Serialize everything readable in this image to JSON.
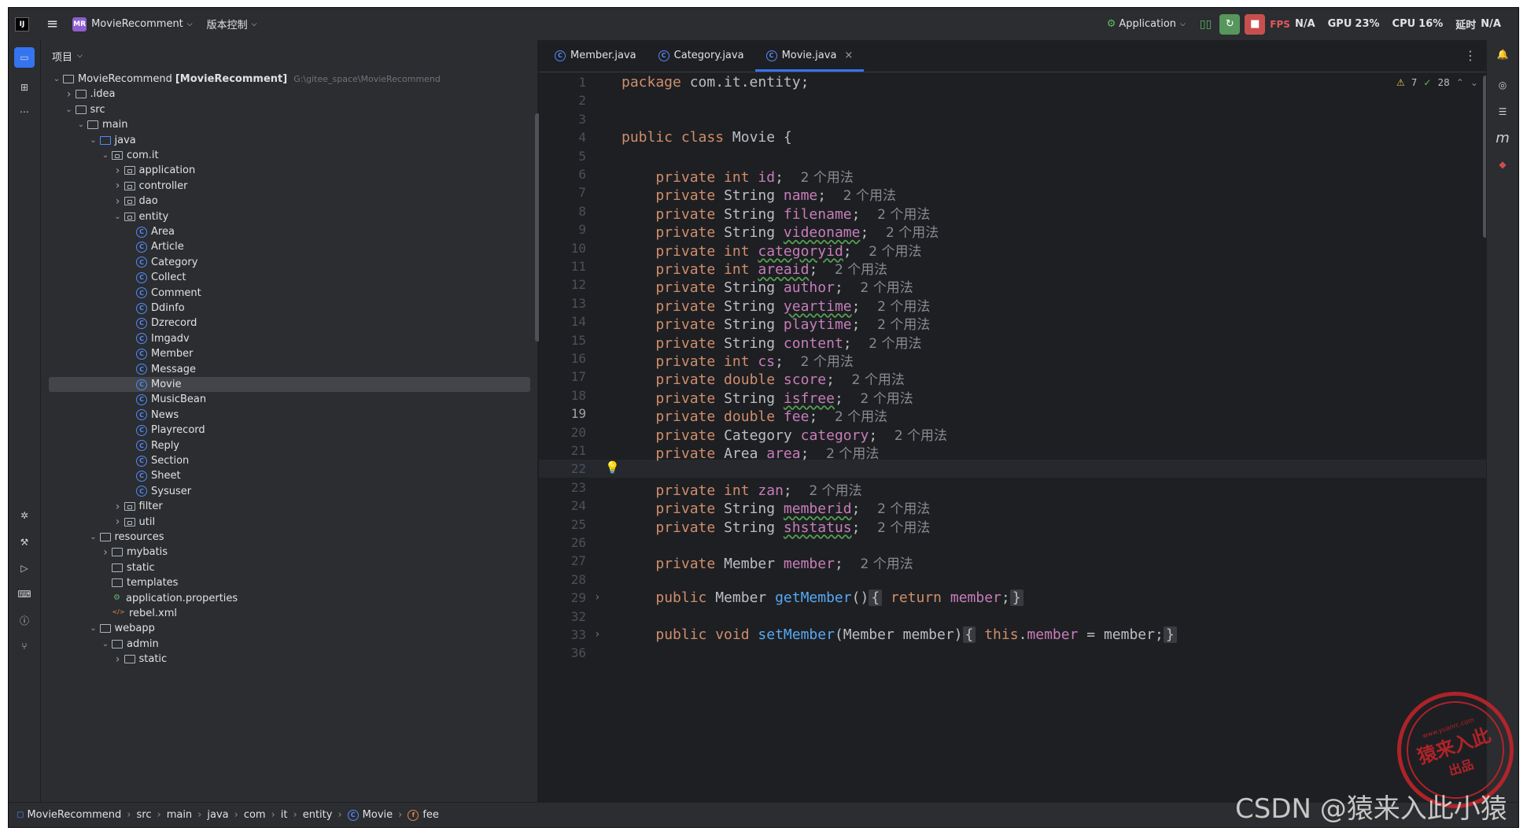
{
  "titlebar": {
    "app_logo": "intellij-icon",
    "project_badge": "MR",
    "project_name": "MovieRecomment",
    "vcs_label": "版本控制",
    "run_config": "Application",
    "fps_label": "FPS",
    "fps_value": "N/A",
    "gpu_label": "GPU",
    "gpu_value": "23%",
    "cpu_label": "CPU",
    "cpu_value": "16%",
    "latency_label": "延时",
    "latency_value": "N/A"
  },
  "project_panel": {
    "title": "项目",
    "tree": [
      {
        "depth": 0,
        "expanded": "open",
        "icon": "module",
        "label": "MovieRecommend",
        "bold": "[MovieRecomment]",
        "path": "G:\\gitee_space\\MovieRecommend"
      },
      {
        "depth": 1,
        "expanded": "closed",
        "icon": "folder",
        "label": ".idea"
      },
      {
        "depth": 1,
        "expanded": "open",
        "icon": "folder",
        "label": "src"
      },
      {
        "depth": 2,
        "expanded": "open",
        "icon": "folder",
        "label": "main"
      },
      {
        "depth": 3,
        "expanded": "open",
        "icon": "folder-src",
        "label": "java"
      },
      {
        "depth": 4,
        "expanded": "open",
        "icon": "package",
        "label": "com.it"
      },
      {
        "depth": 5,
        "expanded": "closed",
        "icon": "package",
        "label": "application"
      },
      {
        "depth": 5,
        "expanded": "closed",
        "icon": "package",
        "label": "controller"
      },
      {
        "depth": 5,
        "expanded": "closed",
        "icon": "package",
        "label": "dao"
      },
      {
        "depth": 5,
        "expanded": "open",
        "icon": "package",
        "label": "entity"
      },
      {
        "depth": 6,
        "expanded": "none",
        "icon": "class",
        "label": "Area"
      },
      {
        "depth": 6,
        "expanded": "none",
        "icon": "class",
        "label": "Article"
      },
      {
        "depth": 6,
        "expanded": "none",
        "icon": "class",
        "label": "Category"
      },
      {
        "depth": 6,
        "expanded": "none",
        "icon": "class",
        "label": "Collect"
      },
      {
        "depth": 6,
        "expanded": "none",
        "icon": "class",
        "label": "Comment"
      },
      {
        "depth": 6,
        "expanded": "none",
        "icon": "class",
        "label": "Ddinfo"
      },
      {
        "depth": 6,
        "expanded": "none",
        "icon": "class",
        "label": "Dzrecord"
      },
      {
        "depth": 6,
        "expanded": "none",
        "icon": "class",
        "label": "Imgadv"
      },
      {
        "depth": 6,
        "expanded": "none",
        "icon": "class",
        "label": "Member"
      },
      {
        "depth": 6,
        "expanded": "none",
        "icon": "class",
        "label": "Message"
      },
      {
        "depth": 6,
        "expanded": "none",
        "icon": "class",
        "label": "Movie",
        "selected": true
      },
      {
        "depth": 6,
        "expanded": "none",
        "icon": "class",
        "label": "MusicBean"
      },
      {
        "depth": 6,
        "expanded": "none",
        "icon": "class",
        "label": "News"
      },
      {
        "depth": 6,
        "expanded": "none",
        "icon": "class",
        "label": "Playrecord"
      },
      {
        "depth": 6,
        "expanded": "none",
        "icon": "class",
        "label": "Reply"
      },
      {
        "depth": 6,
        "expanded": "none",
        "icon": "class",
        "label": "Section"
      },
      {
        "depth": 6,
        "expanded": "none",
        "icon": "class",
        "label": "Sheet"
      },
      {
        "depth": 6,
        "expanded": "none",
        "icon": "class",
        "label": "Sysuser"
      },
      {
        "depth": 5,
        "expanded": "closed",
        "icon": "package",
        "label": "filter"
      },
      {
        "depth": 5,
        "expanded": "closed",
        "icon": "package",
        "label": "util"
      },
      {
        "depth": 3,
        "expanded": "open",
        "icon": "folder-res",
        "label": "resources"
      },
      {
        "depth": 4,
        "expanded": "closed",
        "icon": "folder",
        "label": "mybatis"
      },
      {
        "depth": 4,
        "expanded": "none",
        "icon": "folder",
        "label": "static"
      },
      {
        "depth": 4,
        "expanded": "none",
        "icon": "folder",
        "label": "templates"
      },
      {
        "depth": 4,
        "expanded": "none",
        "icon": "properties",
        "label": "application.properties"
      },
      {
        "depth": 4,
        "expanded": "none",
        "icon": "xml",
        "label": "rebel.xml"
      },
      {
        "depth": 3,
        "expanded": "open",
        "icon": "folder",
        "label": "webapp"
      },
      {
        "depth": 4,
        "expanded": "open",
        "icon": "folder",
        "label": "admin"
      },
      {
        "depth": 5,
        "expanded": "closed",
        "icon": "folder",
        "label": "static"
      }
    ]
  },
  "tabs": [
    {
      "label": "Member.java",
      "active": false
    },
    {
      "label": "Category.java",
      "active": false
    },
    {
      "label": "Movie.java",
      "active": true
    }
  ],
  "inspection": {
    "warnings": "7",
    "ok": "28"
  },
  "editor": {
    "current_line": "19",
    "lines": [
      {
        "n": "1",
        "segs": [
          [
            "kw",
            "package "
          ],
          [
            "",
            "com.it.entity;"
          ]
        ]
      },
      {
        "n": "2",
        "segs": []
      },
      {
        "n": "3",
        "segs": []
      },
      {
        "n": "4",
        "segs": [
          [
            "kw",
            "public class "
          ],
          [
            "",
            "Movie {"
          ]
        ]
      },
      {
        "n": "5",
        "segs": []
      },
      {
        "n": "6",
        "segs": [
          [
            "",
            "    "
          ],
          [
            "kw",
            "private int "
          ],
          [
            "fld",
            "id"
          ],
          [
            "",
            ";  "
          ],
          [
            "hint",
            "2 个用法"
          ]
        ]
      },
      {
        "n": "7",
        "segs": [
          [
            "",
            "    "
          ],
          [
            "kw",
            "private "
          ],
          [
            "",
            "String "
          ],
          [
            "fld",
            "name"
          ],
          [
            "",
            ";  "
          ],
          [
            "hint",
            "2 个用法"
          ]
        ]
      },
      {
        "n": "8",
        "segs": [
          [
            "",
            "    "
          ],
          [
            "kw",
            "private "
          ],
          [
            "",
            "String "
          ],
          [
            "fld",
            "filename"
          ],
          [
            "",
            ";  "
          ],
          [
            "hint",
            "2 个用法"
          ]
        ]
      },
      {
        "n": "9",
        "segs": [
          [
            "",
            "    "
          ],
          [
            "kw",
            "private "
          ],
          [
            "",
            "String "
          ],
          [
            "fld ul",
            "videoname"
          ],
          [
            "",
            ";  "
          ],
          [
            "hint",
            "2 个用法"
          ]
        ]
      },
      {
        "n": "10",
        "segs": [
          [
            "",
            "    "
          ],
          [
            "kw",
            "private int "
          ],
          [
            "fld ul",
            "categoryid"
          ],
          [
            "",
            ";  "
          ],
          [
            "hint",
            "2 个用法"
          ]
        ]
      },
      {
        "n": "11",
        "segs": [
          [
            "",
            "    "
          ],
          [
            "kw",
            "private int "
          ],
          [
            "fld ul",
            "areaid"
          ],
          [
            "",
            ";  "
          ],
          [
            "hint",
            "2 个用法"
          ]
        ]
      },
      {
        "n": "12",
        "segs": [
          [
            "",
            "    "
          ],
          [
            "kw",
            "private "
          ],
          [
            "",
            "String "
          ],
          [
            "fld",
            "author"
          ],
          [
            "",
            ";  "
          ],
          [
            "hint",
            "2 个用法"
          ]
        ]
      },
      {
        "n": "13",
        "segs": [
          [
            "",
            "    "
          ],
          [
            "kw",
            "private "
          ],
          [
            "",
            "String "
          ],
          [
            "fld ul",
            "yeartime"
          ],
          [
            "",
            ";  "
          ],
          [
            "hint",
            "2 个用法"
          ]
        ]
      },
      {
        "n": "14",
        "segs": [
          [
            "",
            "    "
          ],
          [
            "kw",
            "private "
          ],
          [
            "",
            "String "
          ],
          [
            "fld",
            "playtime"
          ],
          [
            "",
            ";  "
          ],
          [
            "hint",
            "2 个用法"
          ]
        ]
      },
      {
        "n": "15",
        "segs": [
          [
            "",
            "    "
          ],
          [
            "kw",
            "private "
          ],
          [
            "",
            "String "
          ],
          [
            "fld",
            "content"
          ],
          [
            "",
            ";  "
          ],
          [
            "hint",
            "2 个用法"
          ]
        ]
      },
      {
        "n": "16",
        "segs": [
          [
            "",
            "    "
          ],
          [
            "kw",
            "private int "
          ],
          [
            "fld",
            "cs"
          ],
          [
            "",
            ";  "
          ],
          [
            "hint",
            "2 个用法"
          ]
        ]
      },
      {
        "n": "17",
        "segs": [
          [
            "",
            "    "
          ],
          [
            "kw",
            "private double "
          ],
          [
            "fld",
            "score"
          ],
          [
            "",
            ";  "
          ],
          [
            "hint",
            "2 个用法"
          ]
        ]
      },
      {
        "n": "18",
        "segs": [
          [
            "",
            "    "
          ],
          [
            "kw",
            "private "
          ],
          [
            "",
            "String "
          ],
          [
            "fld ul",
            "isfree"
          ],
          [
            "",
            ";  "
          ],
          [
            "hint",
            "2 个用法"
          ]
        ]
      },
      {
        "n": "19",
        "segs": [
          [
            "",
            "    "
          ],
          [
            "kw",
            "private double "
          ],
          [
            "fld",
            "fee"
          ],
          [
            "",
            ";  "
          ],
          [
            "hint",
            "2 个用法"
          ]
        ]
      },
      {
        "n": "20",
        "segs": [
          [
            "",
            "    "
          ],
          [
            "kw",
            "private "
          ],
          [
            "",
            "Category "
          ],
          [
            "fld",
            "category"
          ],
          [
            "",
            ";  "
          ],
          [
            "hint",
            "2 个用法"
          ]
        ]
      },
      {
        "n": "21",
        "segs": [
          [
            "",
            "    "
          ],
          [
            "kw",
            "private "
          ],
          [
            "",
            "Area "
          ],
          [
            "fld",
            "area"
          ],
          [
            "",
            ";  "
          ],
          [
            "hint",
            "2 个用法"
          ]
        ]
      },
      {
        "n": "22",
        "segs": []
      },
      {
        "n": "23",
        "segs": [
          [
            "",
            "    "
          ],
          [
            "kw",
            "private int "
          ],
          [
            "fld",
            "zan"
          ],
          [
            "",
            ";  "
          ],
          [
            "hint",
            "2 个用法"
          ]
        ]
      },
      {
        "n": "24",
        "segs": [
          [
            "",
            "    "
          ],
          [
            "kw",
            "private "
          ],
          [
            "",
            "String "
          ],
          [
            "fld ul",
            "memberid"
          ],
          [
            "",
            ";  "
          ],
          [
            "hint",
            "2 个用法"
          ]
        ]
      },
      {
        "n": "25",
        "segs": [
          [
            "",
            "    "
          ],
          [
            "kw",
            "private "
          ],
          [
            "",
            "String "
          ],
          [
            "fld ul",
            "shstatus"
          ],
          [
            "",
            ";  "
          ],
          [
            "hint",
            "2 个用法"
          ]
        ]
      },
      {
        "n": "26",
        "segs": []
      },
      {
        "n": "27",
        "segs": [
          [
            "",
            "    "
          ],
          [
            "kw",
            "private "
          ],
          [
            "",
            "Member "
          ],
          [
            "fld",
            "member"
          ],
          [
            "",
            ";  "
          ],
          [
            "hint",
            "2 个用法"
          ]
        ]
      },
      {
        "n": "28",
        "segs": []
      },
      {
        "n": "29",
        "segs": [
          [
            "",
            "    "
          ],
          [
            "kw",
            "public "
          ],
          [
            "",
            "Member "
          ],
          [
            "fn",
            "getMember"
          ],
          [
            "",
            "()"
          ],
          [
            "fold",
            "{"
          ],
          [
            "",
            " "
          ],
          [
            "kw",
            "return "
          ],
          [
            "fld",
            "member"
          ],
          [
            "",
            ";"
          ],
          [
            "fold",
            "}"
          ]
        ]
      },
      {
        "n": "32",
        "segs": []
      },
      {
        "n": "33",
        "segs": [
          [
            "",
            "    "
          ],
          [
            "kw",
            "public void "
          ],
          [
            "fn",
            "setMember"
          ],
          [
            "",
            "(Member member)"
          ],
          [
            "fold",
            "{"
          ],
          [
            "",
            " "
          ],
          [
            "kw",
            "this"
          ],
          [
            "",
            "."
          ],
          [
            "fld",
            "member"
          ],
          [
            "",
            " = member;"
          ],
          [
            "fold",
            "}"
          ]
        ]
      },
      {
        "n": "36",
        "segs": []
      }
    ]
  },
  "breadcrumb": [
    "MovieRecommend",
    "src",
    "main",
    "java",
    "com",
    "it",
    "entity",
    "Movie",
    "fee"
  ],
  "watermark": {
    "text": "CSDN @猿来入此小猿",
    "stamp_url": "www.yuanrc.com",
    "stamp_main": "猿来入此",
    "stamp_sub": "出品"
  }
}
